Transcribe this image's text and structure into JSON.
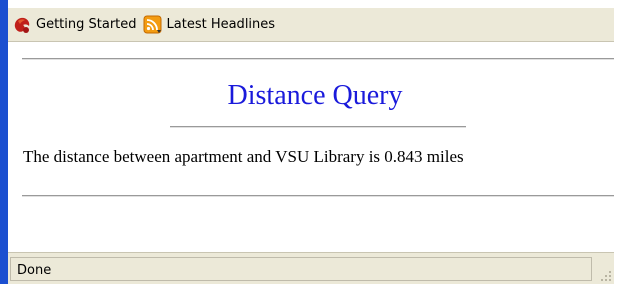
{
  "bookmarks": [
    {
      "label": "Getting Started",
      "icon": "firefox-icon"
    },
    {
      "label": "Latest Headlines",
      "icon": "rss-feed-icon"
    }
  ],
  "page": {
    "title": "Distance Query",
    "result": "The distance between apartment and VSU Library is 0.843 miles"
  },
  "status": {
    "text": "Done"
  },
  "colors": {
    "title": "#1a1adb",
    "chrome": "#ece9d8",
    "window_edge": "#1b4fd0"
  }
}
